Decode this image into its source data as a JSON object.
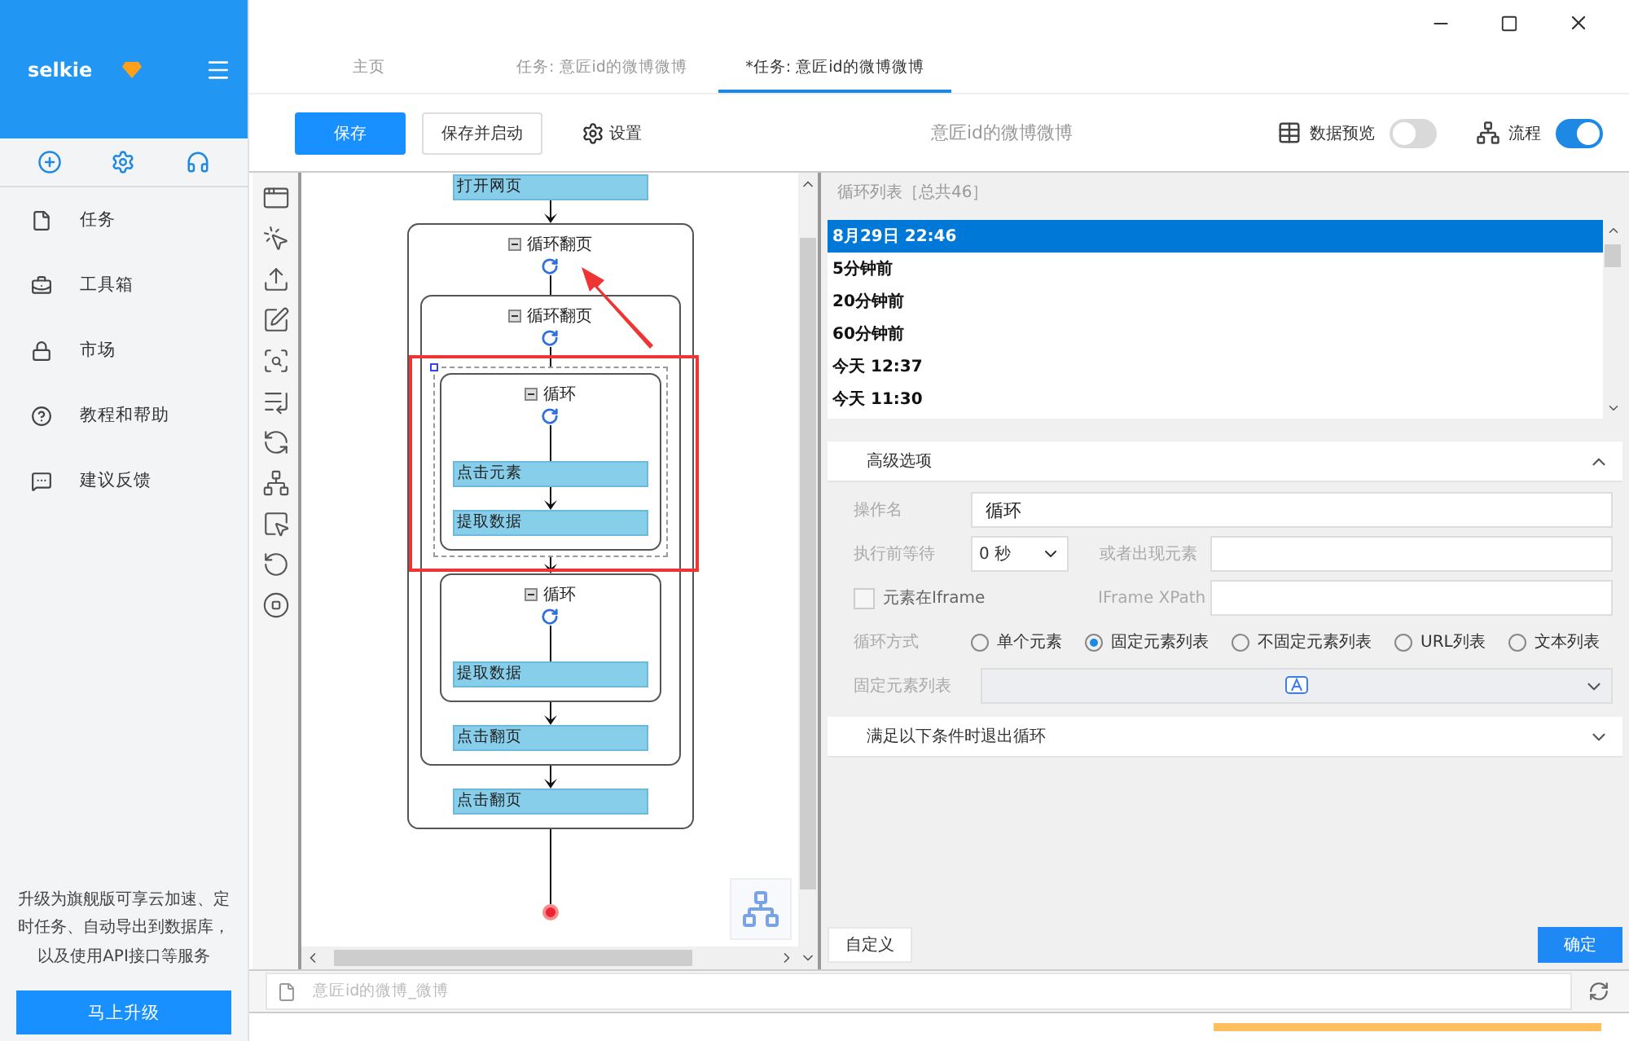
{
  "sidebar": {
    "brand": "selkie",
    "nav": [
      {
        "label": "任务"
      },
      {
        "label": "工具箱"
      },
      {
        "label": "市场"
      },
      {
        "label": "教程和帮助"
      },
      {
        "label": "建议反馈"
      }
    ],
    "promo": "升级为旗舰版可享云加速、定时任务、自动导出到数据库，以及使用API接口等服务",
    "upgrade_button": "马上升级"
  },
  "tabs": [
    {
      "label": "主页",
      "selected": false
    },
    {
      "label": "任务: 意匠id的微博微博",
      "selected": false
    },
    {
      "label": "*任务: 意匠id的微博微博",
      "selected": true
    }
  ],
  "toolbar": {
    "save": "保存",
    "save_and_start": "保存并启动",
    "settings": "设置",
    "task_name": "意匠id的微博微博",
    "data_preview": {
      "label": "数据预览",
      "on": false
    },
    "flow_toggle": {
      "label": "流程",
      "on": true
    }
  },
  "flow": [
    {
      "kind": "action",
      "label": "打开网页"
    },
    {
      "kind": "loop",
      "label": "循环翻页",
      "selected": false,
      "children": [
        {
          "kind": "loop",
          "label": "循环翻页",
          "selected": false,
          "children": [
            {
              "kind": "loop",
              "label": "循环",
              "selected": true,
              "children": [
                {
                  "kind": "action",
                  "label": "点击元素"
                },
                {
                  "kind": "action",
                  "label": "提取数据"
                }
              ]
            },
            {
              "kind": "loop",
              "label": "循环",
              "selected": false,
              "children": [
                {
                  "kind": "action",
                  "label": "提取数据"
                }
              ]
            },
            {
              "kind": "action",
              "label": "点击翻页"
            }
          ]
        },
        {
          "kind": "action",
          "label": "点击翻页"
        }
      ]
    }
  ],
  "loop_list": {
    "title": "循环列表［总共46］",
    "items": [
      {
        "label": "8月29日 22:46",
        "selected": true
      },
      {
        "label": "5分钟前",
        "selected": false
      },
      {
        "label": "20分钟前",
        "selected": false
      },
      {
        "label": "60分钟前",
        "selected": false
      },
      {
        "label": "今天 12:37",
        "selected": false
      },
      {
        "label": "今天 11:30",
        "selected": false
      }
    ]
  },
  "advanced": {
    "title": "高级选项",
    "expanded": true,
    "operation_name": {
      "label": "操作名",
      "value": "循环"
    },
    "wait": {
      "label": "执行前等待",
      "value": "0 秒"
    },
    "appear_element": {
      "label": "或者出现元素"
    },
    "in_iframe": {
      "label": "元素在Iframe",
      "checked": false
    },
    "iframe_xpath": {
      "label": "IFrame XPath"
    },
    "loop_mode": {
      "label": "循环方式",
      "options": [
        {
          "label": "单个元素",
          "selected": false
        },
        {
          "label": "固定元素列表",
          "selected": true
        },
        {
          "label": "不固定元素列表",
          "selected": false
        },
        {
          "label": "URL列表",
          "selected": false
        },
        {
          "label": "文本列表",
          "selected": false
        }
      ]
    },
    "fixed_list": {
      "label": "固定元素列表"
    }
  },
  "exit_condition": {
    "title": "满足以下条件时退出循环",
    "expanded": false
  },
  "custom_button": "自定义",
  "ok_button": "确定",
  "file_bar": {
    "placeholder": "意匠id的微博_微博"
  }
}
